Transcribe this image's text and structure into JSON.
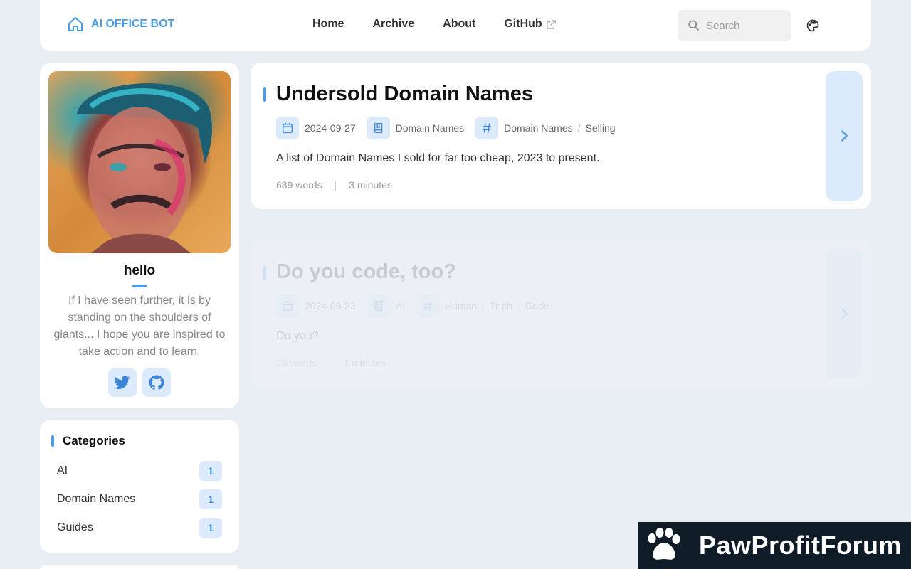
{
  "nav": {
    "brand": "AI OFFICE BOT",
    "links": [
      {
        "label": "Home"
      },
      {
        "label": "Archive"
      },
      {
        "label": "About"
      },
      {
        "label": "GitHub"
      }
    ],
    "search_placeholder": "Search"
  },
  "profile": {
    "name": "hello",
    "bio": "If I have seen further, it is by standing on the shoulders of giants... I hope you are inspired to take action and to learn."
  },
  "categories": {
    "title": "Categories",
    "items": [
      {
        "label": "AI",
        "count": "1"
      },
      {
        "label": "Domain Names",
        "count": "1"
      },
      {
        "label": "Guides",
        "count": "1"
      }
    ]
  },
  "posts": [
    {
      "title": "Undersold Domain Names",
      "date": "2024-09-27",
      "category": "Domain Names",
      "tags": [
        "Domain Names",
        "Selling"
      ],
      "excerpt": "A list of Domain Names I sold for far too cheap, 2023 to present.",
      "words": "639 words",
      "reading_time": "3 minutes"
    },
    {
      "title": "Do you code, too?",
      "date": "2024-09-23",
      "category": "AI",
      "tags": [
        "Human",
        "Truth",
        "Code"
      ],
      "excerpt": "Do you?",
      "words": "28 words",
      "reading_time": "1 minutes"
    }
  ],
  "watermark": "PawProfitForum",
  "colors": {
    "accent": "#4a9be6",
    "accent_bg": "#dcebfb",
    "page_bg": "#e9eef5"
  }
}
